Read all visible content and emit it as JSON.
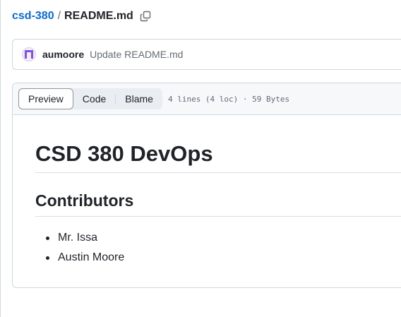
{
  "breadcrumb": {
    "repo": "csd-380",
    "separator": "/",
    "file": "README.md",
    "copy_icon": "copy-icon"
  },
  "commit": {
    "avatar_icon": "identicon-avatar",
    "author": "aumoore",
    "message": "Update README.md"
  },
  "file_header": {
    "tabs": [
      {
        "label": "Preview",
        "active": true
      },
      {
        "label": "Code",
        "active": false
      },
      {
        "label": "Blame",
        "active": false
      }
    ],
    "info": "4 lines (4 loc) · 59 Bytes"
  },
  "readme": {
    "h1": "CSD 380 DevOps",
    "h2": "Contributors",
    "items": [
      "Mr. Issa",
      "Austin Moore"
    ]
  },
  "colors": {
    "link": "#0969da",
    "text": "#1f2328",
    "muted": "#656d76",
    "border": "#d0d7de",
    "avatar_accent": "#8250df"
  }
}
